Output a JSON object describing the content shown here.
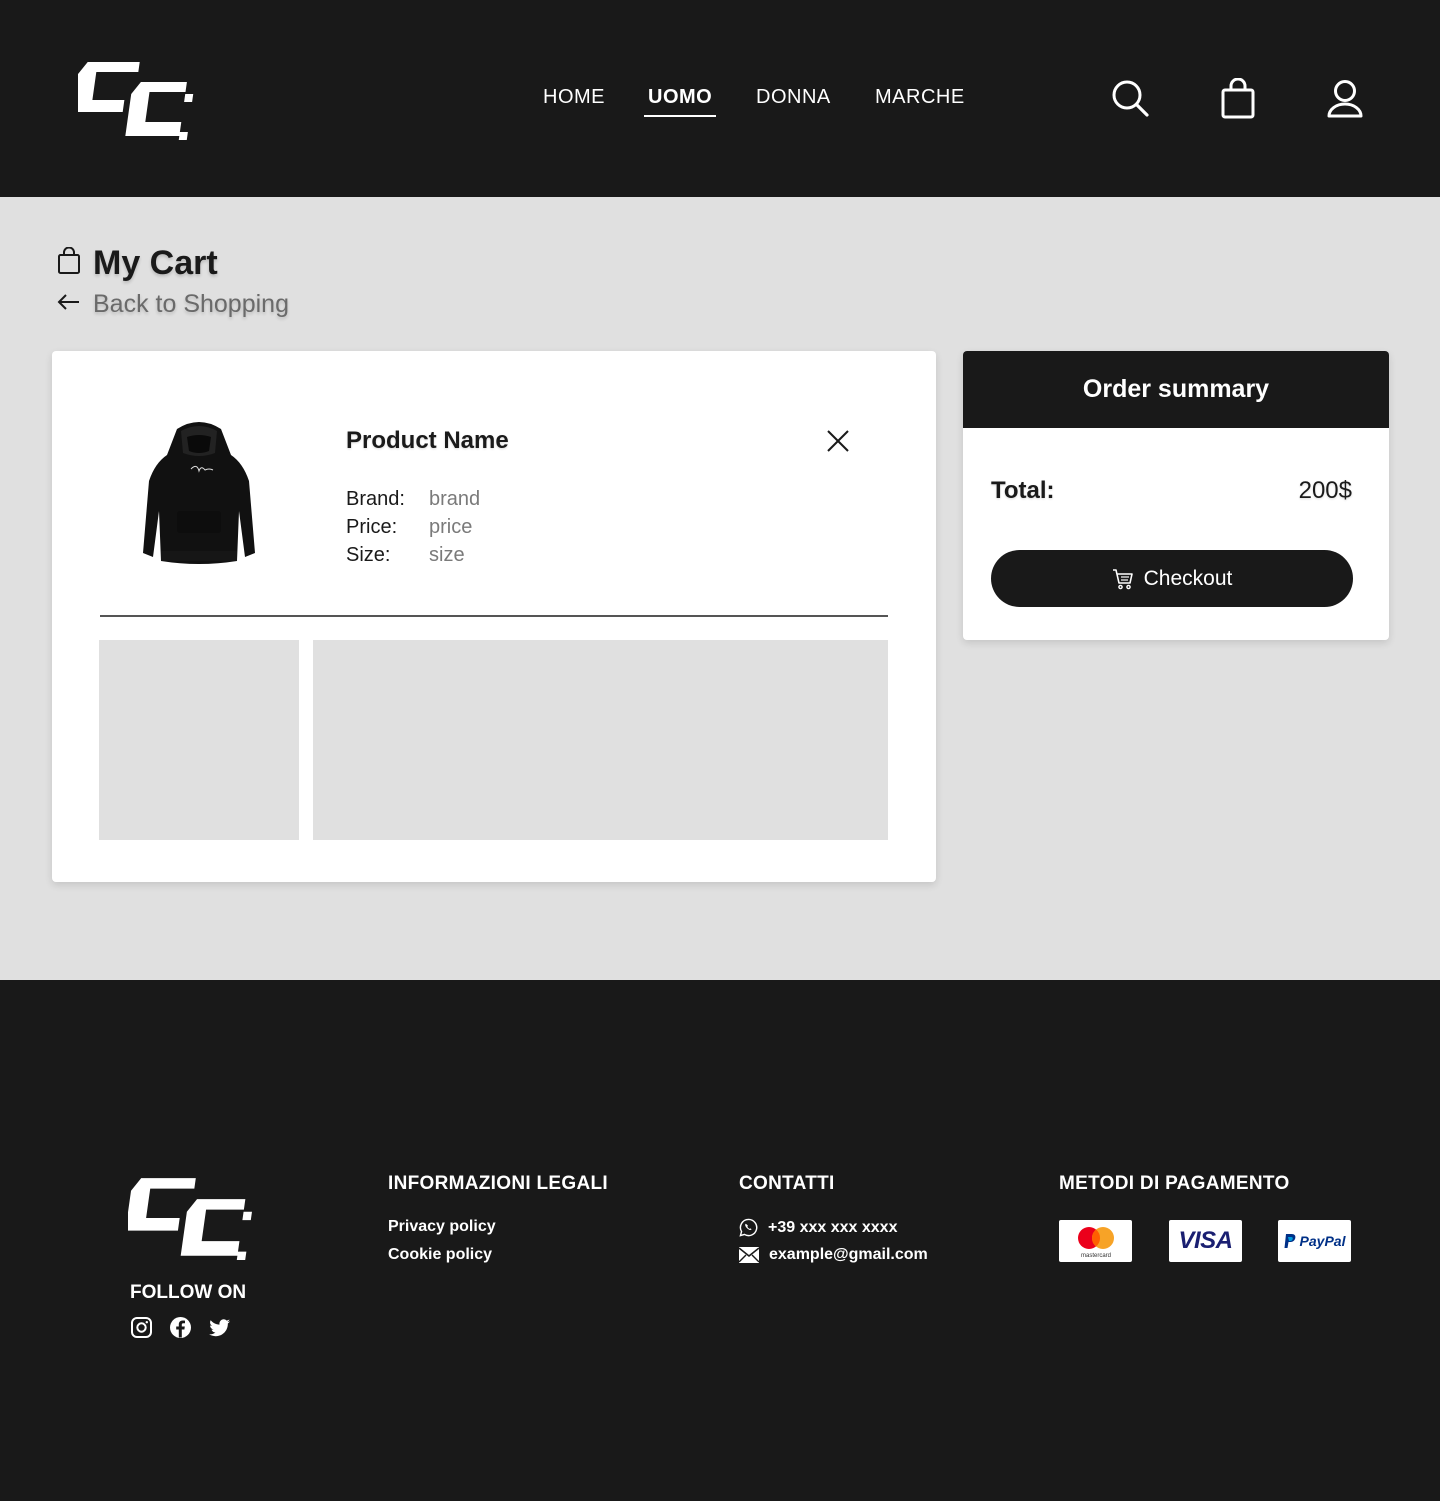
{
  "header": {
    "nav": [
      {
        "label": "HOME"
      },
      {
        "label": "UOMO"
      },
      {
        "label": "DONNA"
      },
      {
        "label": "MARCHE"
      }
    ],
    "icons": [
      "search-icon",
      "shopping-bag-icon",
      "user-icon"
    ]
  },
  "page": {
    "title": "My Cart",
    "back_label": "Back to Shopping"
  },
  "cart": {
    "item": {
      "name": "Product Name",
      "brand_label": "Brand:",
      "brand_value": "brand",
      "price_label": "Price:",
      "price_value": "price",
      "size_label": "Size:",
      "size_value": "size"
    }
  },
  "summary": {
    "title": "Order summary",
    "total_label": "Total:",
    "total_value": "200$",
    "checkout_label": "Checkout"
  },
  "footer": {
    "follow_label": "FOLLOW ON",
    "legal": {
      "title": "INFORMAZIONI LEGALI",
      "links": [
        "Privacy policy",
        "Cookie policy"
      ]
    },
    "contacts": {
      "title": "CONTATTI",
      "phone": "+39 xxx xxx xxxx",
      "email": "example@gmail.com"
    },
    "payments": {
      "title": "METODI DI PAGAMENTO",
      "methods": [
        "mastercard",
        "VISA",
        "PayPal"
      ]
    }
  },
  "colors": {
    "dark": "#191919",
    "background": "#e0e0e0",
    "card": "#ffffff",
    "muted_text": "#7a7a7a"
  }
}
